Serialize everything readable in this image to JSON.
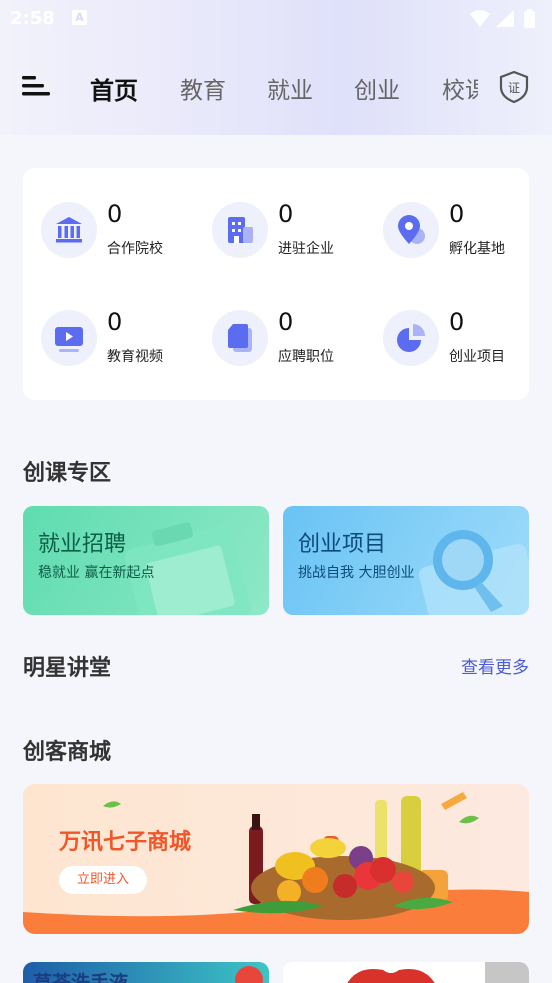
{
  "status_bar": {
    "time": "2:58",
    "notification_glyph": "A"
  },
  "nav": {
    "tabs": [
      {
        "label": "首页",
        "active": true
      },
      {
        "label": "教育",
        "active": false
      },
      {
        "label": "就业",
        "active": false
      },
      {
        "label": "创业",
        "active": false
      },
      {
        "label": "校课",
        "active": false
      }
    ],
    "cert_icon_text": "证"
  },
  "stats": [
    {
      "value": "0",
      "label": "合作院校",
      "icon": "institution-icon"
    },
    {
      "value": "0",
      "label": "进驻企业",
      "icon": "building-icon"
    },
    {
      "value": "0",
      "label": "孵化基地",
      "icon": "location-pin-icon"
    },
    {
      "value": "0",
      "label": "教育视频",
      "icon": "video-icon"
    },
    {
      "value": "0",
      "label": "应聘职位",
      "icon": "document-icon"
    },
    {
      "value": "0",
      "label": "创业项目",
      "icon": "pie-chart-icon"
    }
  ],
  "sections": {
    "course_zone": "创课专区",
    "star_lecture": "明星讲堂",
    "more_link": "查看更多",
    "maker_mall": "创客商城"
  },
  "promos": {
    "employment": {
      "title": "就业招聘",
      "subtitle": "稳就业 赢在新起点"
    },
    "startup": {
      "title": "创业项目",
      "subtitle": "挑战自我 大胆创业"
    }
  },
  "mall_banner": {
    "title": "万讯七子商城",
    "button": "立即进入"
  },
  "product_thumbs": {
    "left_text": "草荟洗手液"
  },
  "colors": {
    "accent": "#4c5bd8",
    "icon_blue": "#5b6cf0",
    "promo_green": "#5fdcb0",
    "promo_blue": "#69c3f4",
    "mall_orange": "#f0562a"
  }
}
